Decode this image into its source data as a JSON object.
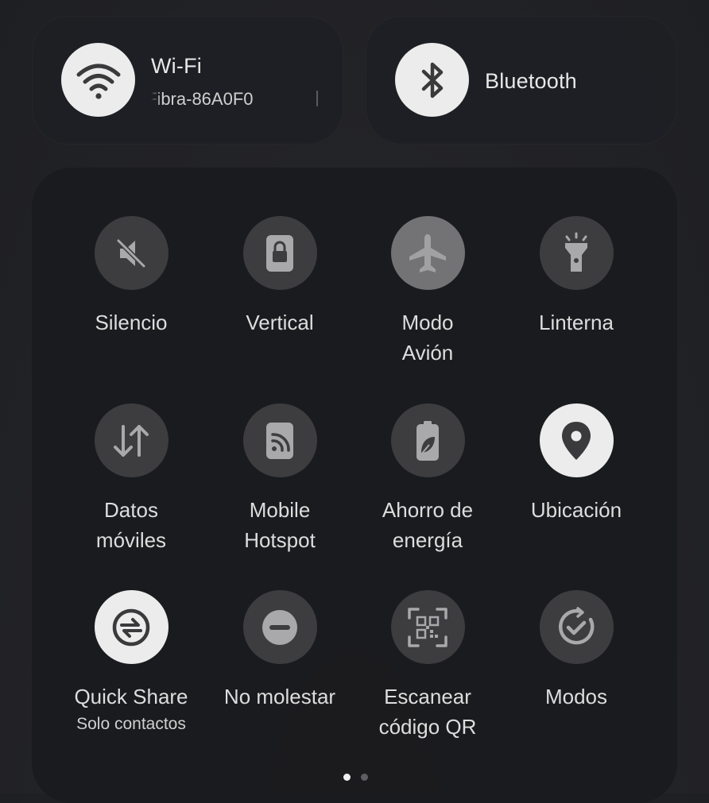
{
  "wifi": {
    "title": "Wi-Fi",
    "network": "Fibra-86A0F0",
    "icon": "wifi-icon",
    "active": true
  },
  "bluetooth": {
    "title": "Bluetooth",
    "icon": "bluetooth-icon",
    "active": true
  },
  "tiles": [
    {
      "label": "Silencio",
      "icon": "mute-icon",
      "state": "off"
    },
    {
      "label": "Vertical",
      "icon": "rotation-lock-icon",
      "state": "off"
    },
    {
      "label": "Modo\nAvión",
      "icon": "airplane-icon",
      "state": "unavailable"
    },
    {
      "label": "Linterna",
      "icon": "flashlight-icon",
      "state": "off"
    },
    {
      "label": "Datos\nmóviles",
      "icon": "mobile-data-icon",
      "state": "off"
    },
    {
      "label": "Mobile\nHotspot",
      "icon": "hotspot-icon",
      "state": "off"
    },
    {
      "label": "Ahorro de\nenergía",
      "icon": "power-saving-icon",
      "state": "off"
    },
    {
      "label": "Ubicación",
      "icon": "location-icon",
      "state": "on"
    },
    {
      "label": "Quick Share",
      "sublabel": "Solo contactos",
      "icon": "quick-share-icon",
      "state": "on"
    },
    {
      "label": "No molestar",
      "icon": "do-not-disturb-icon",
      "state": "off"
    },
    {
      "label": "Escanear\ncódigo QR",
      "icon": "qr-scan-icon",
      "state": "off"
    },
    {
      "label": "Modos",
      "icon": "modes-icon",
      "state": "off"
    }
  ],
  "pagination": {
    "pages": 2,
    "current": 1
  },
  "colors": {
    "active_bg": "#ececec",
    "inactive_bg": "#3d3d40",
    "unavailable_bg": "#737375",
    "panel_bg": "#1a1b1e"
  }
}
